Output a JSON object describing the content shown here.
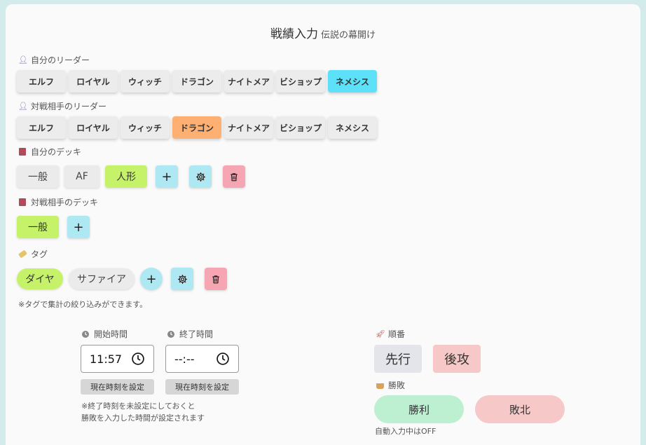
{
  "header": {
    "title": "戦績入力",
    "subtitle": "伝説の幕開け"
  },
  "my_leader": {
    "label": "自分のリーダー",
    "icon": "person-icon",
    "options": [
      "エルフ",
      "ロイヤル",
      "ウィッチ",
      "ドラゴン",
      "ナイトメア",
      "ビショップ",
      "ネメシス"
    ],
    "selected": "ネメシス",
    "selected_color": "#5ce1f8"
  },
  "opp_leader": {
    "label": "対戦相手のリーダー",
    "icon": "person-icon",
    "options": [
      "エルフ",
      "ロイヤル",
      "ウィッチ",
      "ドラゴン",
      "ナイトメア",
      "ビショップ",
      "ネメシス"
    ],
    "selected": "ドラゴン",
    "selected_color": "#fdb071"
  },
  "my_deck": {
    "label": "自分のデッキ",
    "icon": "book-icon",
    "options": [
      "一般",
      "AF",
      "人形"
    ],
    "selected": "人形"
  },
  "opp_deck": {
    "label": "対戦相手のデッキ",
    "icon": "book-icon",
    "options": [
      "一般"
    ],
    "selected": "一般"
  },
  "tags": {
    "label": "タグ",
    "icon": "tag-icon",
    "options": [
      "ダイヤ",
      "サファイア"
    ],
    "selected": "ダイヤ",
    "note": "※タグで集計の絞り込みができます。"
  },
  "time": {
    "start_label": "開始時間",
    "start_value": "11:57",
    "end_label": "終了時間",
    "end_value": "--:--",
    "set_now": "現在時刻を設定",
    "note_line1": "※終了時刻を未設定にしておくと",
    "note_line2": "勝敗を入力した時間が設定されます"
  },
  "order": {
    "label": "順番",
    "icon": "rocket-icon",
    "first": "先行",
    "second": "後攻",
    "selected": "後攻"
  },
  "result": {
    "label": "勝敗",
    "icon": "basket-icon",
    "win": "勝利",
    "lose": "敗北",
    "auto_note": "自動入力中はOFF"
  },
  "colors": {
    "background": "#d4ebec",
    "accent_green": "#c6f26a",
    "accent_cyan": "#aee9f3",
    "accent_pink": "#f6a6b2",
    "win": "#bdefd1",
    "lose": "#f7c8c8"
  }
}
